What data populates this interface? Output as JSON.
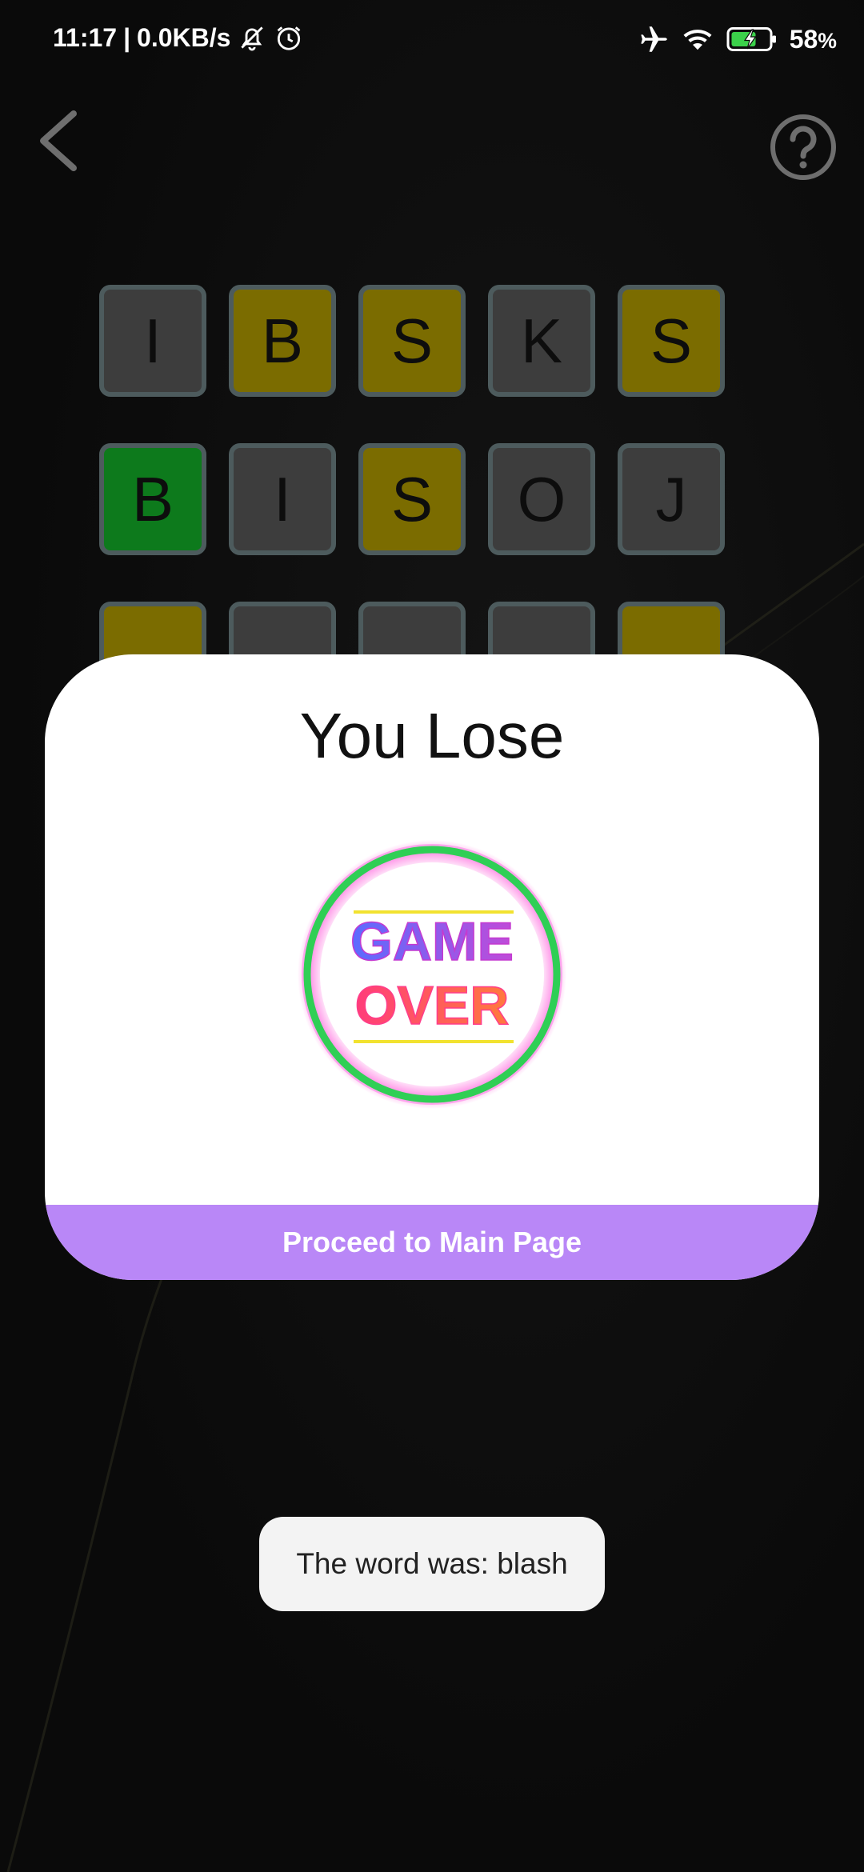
{
  "status_bar": {
    "time": "11:17",
    "separator": "|",
    "network_speed": "0.0KB/s",
    "battery_percent": "58",
    "battery_unit": "%",
    "icons": [
      "mute-icon",
      "alarm-icon",
      "airplane-icon",
      "wifi-icon",
      "battery-charging-icon"
    ]
  },
  "nav": {
    "back_icon": "chevron-left-icon",
    "help_icon": "question-circle-icon"
  },
  "board": {
    "rows": [
      [
        {
          "letter": "I",
          "state": "absent"
        },
        {
          "letter": "B",
          "state": "present"
        },
        {
          "letter": "S",
          "state": "present"
        },
        {
          "letter": "K",
          "state": "absent"
        },
        {
          "letter": "S",
          "state": "present"
        }
      ],
      [
        {
          "letter": "B",
          "state": "correct"
        },
        {
          "letter": "I",
          "state": "absent"
        },
        {
          "letter": "S",
          "state": "present"
        },
        {
          "letter": "O",
          "state": "absent"
        },
        {
          "letter": "J",
          "state": "absent"
        }
      ],
      [
        {
          "letter": "",
          "state": "present"
        },
        {
          "letter": "",
          "state": "absent"
        },
        {
          "letter": "",
          "state": "absent"
        },
        {
          "letter": "",
          "state": "absent"
        },
        {
          "letter": "",
          "state": "present"
        }
      ]
    ],
    "colors": {
      "absent": "#3d3d3d",
      "present": "#7b6c00",
      "correct": "#0d7a1c",
      "border": "#4d5b5d"
    }
  },
  "modal": {
    "title": "You Lose",
    "badge_line1": "GAME",
    "badge_line2": "OVER",
    "button_label": "Proceed to Main Page",
    "button_color": "#b987f7"
  },
  "toast": {
    "message": "The word was: blash"
  }
}
